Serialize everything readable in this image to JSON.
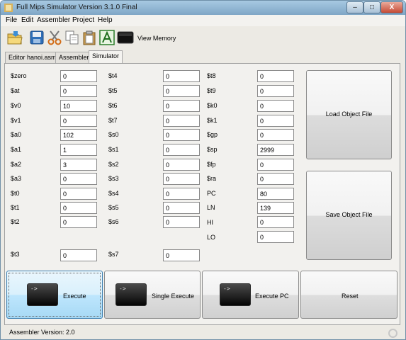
{
  "window": {
    "title": "Full Mips Simulator Version 3.1.0 Final",
    "minimize": "–",
    "maximize": "□",
    "close": "X"
  },
  "menu": [
    "File",
    "Edit",
    "Assembler",
    "Project",
    "Help"
  ],
  "toolbar": {
    "view_memory_label": "View Memory"
  },
  "tabs": [
    "Editor hanoi.asm",
    "Assembler",
    "Simulator"
  ],
  "registers": {
    "col1": [
      {
        "name": "$zero",
        "value": "0"
      },
      {
        "name": "$at",
        "value": "0"
      },
      {
        "name": "$v0",
        "value": "10"
      },
      {
        "name": "$v1",
        "value": "0"
      },
      {
        "name": "$a0",
        "value": "102"
      },
      {
        "name": "$a1",
        "value": "1"
      },
      {
        "name": "$a2",
        "value": "3"
      },
      {
        "name": "$a3",
        "value": "0"
      },
      {
        "name": "$t0",
        "value": "0"
      },
      {
        "name": "$t1",
        "value": "0"
      },
      {
        "name": "$t2",
        "value": "0"
      },
      {
        "name": "$t3",
        "value": "0"
      }
    ],
    "col2": [
      {
        "name": "$t4",
        "value": "0"
      },
      {
        "name": "$t5",
        "value": "0"
      },
      {
        "name": "$t6",
        "value": "0"
      },
      {
        "name": "$t7",
        "value": "0"
      },
      {
        "name": "$s0",
        "value": "0"
      },
      {
        "name": "$s1",
        "value": "0"
      },
      {
        "name": "$s2",
        "value": "0"
      },
      {
        "name": "$s3",
        "value": "0"
      },
      {
        "name": "$s4",
        "value": "0"
      },
      {
        "name": "$s5",
        "value": "0"
      },
      {
        "name": "$s6",
        "value": "0"
      },
      {
        "name": "$s7",
        "value": "0"
      }
    ],
    "col3": [
      {
        "name": "$t8",
        "value": "0"
      },
      {
        "name": "$t9",
        "value": "0"
      },
      {
        "name": "$k0",
        "value": "0"
      },
      {
        "name": "$k1",
        "value": "0"
      },
      {
        "name": "$gp",
        "value": "0"
      },
      {
        "name": "$sp",
        "value": "2999"
      },
      {
        "name": "$fp",
        "value": "0"
      },
      {
        "name": "$ra",
        "value": "0"
      },
      {
        "name": "PC",
        "value": "80"
      },
      {
        "name": "LN",
        "value": "139"
      },
      {
        "name": "HI",
        "value": "0"
      },
      {
        "name": "LO",
        "value": "0"
      }
    ]
  },
  "side_buttons": {
    "load": "Load Object File",
    "save": "Save Object File"
  },
  "exec_buttons": {
    "execute": "Execute",
    "single": "Single Execute",
    "execute_pc": "Execute PC",
    "reset": "Reset",
    "prompt": "->"
  },
  "status": {
    "text": "Assembler Version:  2.0"
  }
}
